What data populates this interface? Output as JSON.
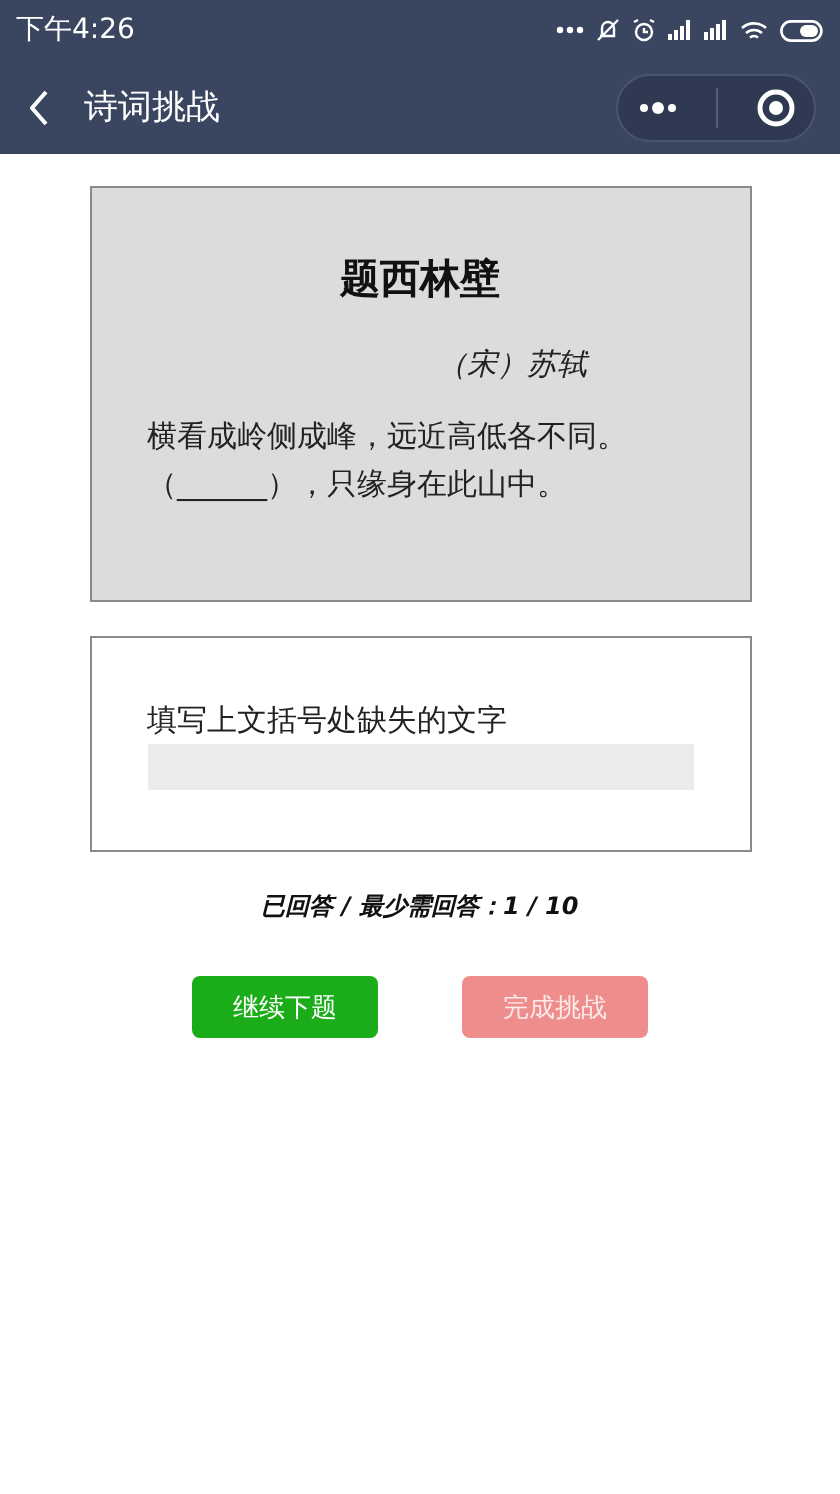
{
  "status_bar": {
    "time": "下午4:26"
  },
  "nav": {
    "title": "诗词挑战"
  },
  "poem": {
    "title": "题西林壁",
    "author": "（宋）苏轼",
    "lines": [
      "横看成岭侧成峰，远近高低各不同。",
      "（______），只缘身在此山中。"
    ]
  },
  "answer": {
    "prompt": "填写上文括号处缺失的文字"
  },
  "progress": "已回答 / 最少需回答：1 / 10",
  "buttons": [
    {
      "label": "继续下题",
      "kind": "primary",
      "disabled": false
    },
    {
      "label": "完成挑战",
      "kind": "warn",
      "disabled": true
    }
  ]
}
